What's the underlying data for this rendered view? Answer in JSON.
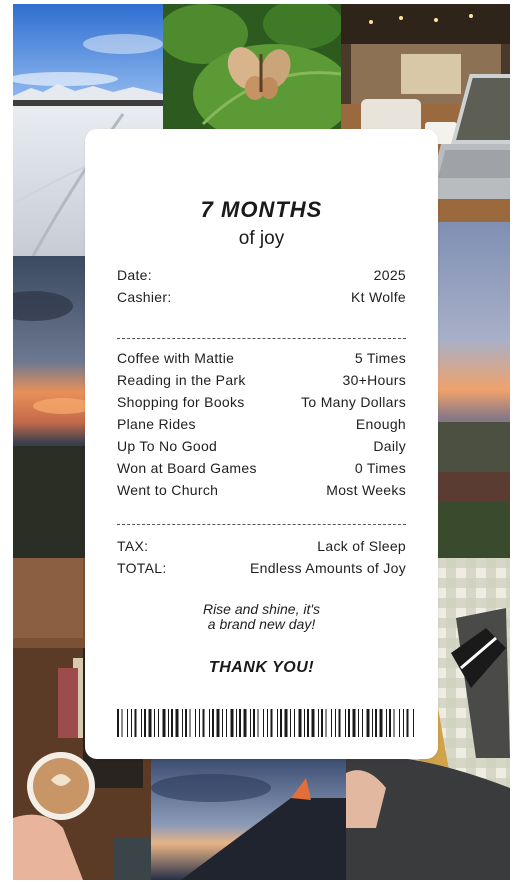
{
  "receipt": {
    "title": "7 MONTHS",
    "subtitle": "of joy",
    "header": [
      {
        "label": "Date:",
        "value": "2025"
      },
      {
        "label": "Cashier:",
        "value": "Kt Wolfe"
      }
    ],
    "items": [
      {
        "label": "Coffee with Mattie",
        "value": "5 Times"
      },
      {
        "label": "Reading in the Park",
        "value": "30+Hours"
      },
      {
        "label": "Shopping for Books",
        "value": "To Many Dollars"
      },
      {
        "label": "Plane Rides",
        "value": "Enough"
      },
      {
        "label": "Up To No Good",
        "value": "Daily"
      },
      {
        "label": "Won at Board Games",
        "value": "0 Times"
      },
      {
        "label": "Went to Church",
        "value": "Most Weeks"
      }
    ],
    "totals": [
      {
        "label": "TAX:",
        "value": "Lack of Sleep"
      },
      {
        "label": "TOTAL:",
        "value": "Endless Amounts of Joy"
      }
    ],
    "footer_line1": "Rise and shine, it's",
    "footer_line2": "a brand new day!",
    "thanks": "THANK YOU!"
  },
  "photos": [
    {
      "name": "frozen-lake-photo"
    },
    {
      "name": "butterfly-photo"
    },
    {
      "name": "cafe-laptop-photo"
    },
    {
      "name": "sunset-clouds-photo"
    },
    {
      "name": "city-sunset-photo"
    },
    {
      "name": "latte-books-photo"
    },
    {
      "name": "airplane-wing-photo"
    },
    {
      "name": "picnic-blanket-photo"
    }
  ],
  "colors": {
    "receipt_bg": "#ffffff",
    "text": "#1f1f1f"
  }
}
